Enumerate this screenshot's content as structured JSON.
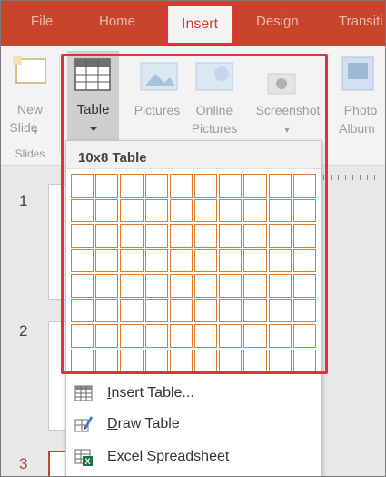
{
  "tabs": {
    "file": "File",
    "home": "Home",
    "insert": "Insert",
    "design": "Design",
    "transitions": "Transiti"
  },
  "ribbon": {
    "new_slide": "New",
    "new_slide_2": "Slide",
    "slides_group": "Slides",
    "table": "Table",
    "pictures": "Pictures",
    "online_pictures": "Online",
    "online_pictures_2": "Pictures",
    "screenshot": "Screenshot",
    "photo_album": "Photo",
    "photo_album_2": "Album"
  },
  "slides": {
    "numbers": [
      "1",
      "2",
      "3"
    ]
  },
  "dropdown": {
    "title": "10x8 Table",
    "grid": {
      "columns": 10,
      "rows": 8
    },
    "items": [
      {
        "label_prefix": "",
        "label_underlined": "I",
        "label_rest": "nsert Table...",
        "icon": "insert-table-icon"
      },
      {
        "label_prefix": "",
        "label_underlined": "D",
        "label_rest": "raw Table",
        "icon": "draw-table-pencil-icon"
      },
      {
        "label_prefix": "E",
        "label_underlined": "x",
        "label_rest": "cel Spreadsheet",
        "icon": "excel-icon"
      }
    ]
  },
  "colors": {
    "tab_bar": "#c8442b",
    "highlight": "#e0323c",
    "grid_cell_border": "#e07a2a",
    "excel_green": "#1e7145"
  }
}
